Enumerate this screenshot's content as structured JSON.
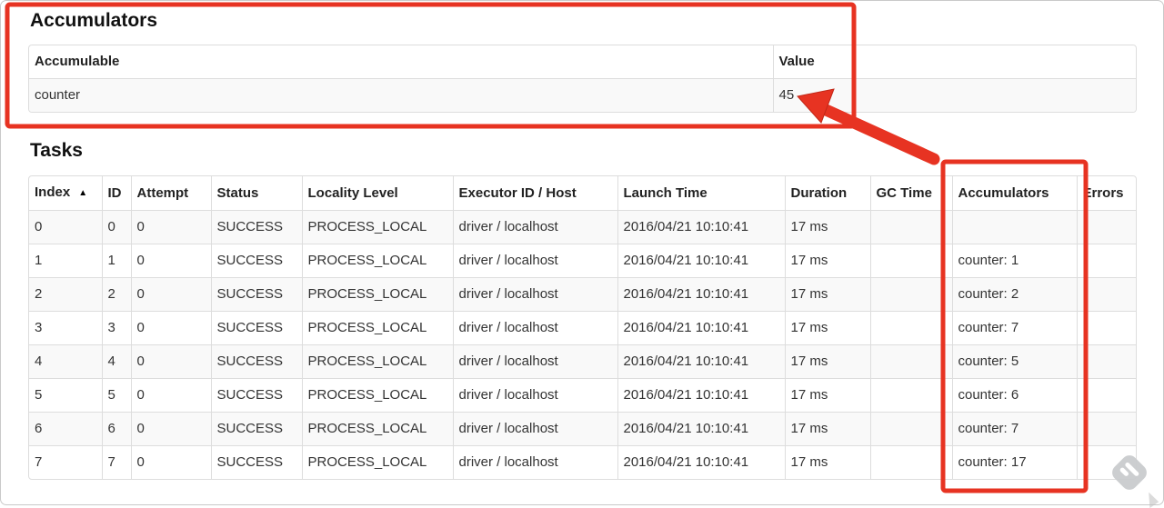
{
  "accumulators_section": {
    "title": "Accumulators",
    "table": {
      "headers": [
        "Accumulable",
        "Value"
      ],
      "rows": [
        [
          "counter",
          "45"
        ]
      ]
    }
  },
  "tasks_section": {
    "title": "Tasks",
    "table": {
      "columns": [
        {
          "label": "Index",
          "sort": "▲"
        },
        {
          "label": "ID"
        },
        {
          "label": "Attempt"
        },
        {
          "label": "Status"
        },
        {
          "label": "Locality Level"
        },
        {
          "label": "Executor ID / Host"
        },
        {
          "label": "Launch Time"
        },
        {
          "label": "Duration"
        },
        {
          "label": "GC Time"
        },
        {
          "label": "Accumulators"
        },
        {
          "label": "Errors"
        }
      ],
      "rows": [
        [
          "0",
          "0",
          "0",
          "SUCCESS",
          "PROCESS_LOCAL",
          "driver / localhost",
          "2016/04/21 10:10:41",
          "17 ms",
          "",
          "",
          ""
        ],
        [
          "1",
          "1",
          "0",
          "SUCCESS",
          "PROCESS_LOCAL",
          "driver / localhost",
          "2016/04/21 10:10:41",
          "17 ms",
          "",
          "counter: 1",
          ""
        ],
        [
          "2",
          "2",
          "0",
          "SUCCESS",
          "PROCESS_LOCAL",
          "driver / localhost",
          "2016/04/21 10:10:41",
          "17 ms",
          "",
          "counter: 2",
          ""
        ],
        [
          "3",
          "3",
          "0",
          "SUCCESS",
          "PROCESS_LOCAL",
          "driver / localhost",
          "2016/04/21 10:10:41",
          "17 ms",
          "",
          "counter: 7",
          ""
        ],
        [
          "4",
          "4",
          "0",
          "SUCCESS",
          "PROCESS_LOCAL",
          "driver / localhost",
          "2016/04/21 10:10:41",
          "17 ms",
          "",
          "counter: 5",
          ""
        ],
        [
          "5",
          "5",
          "0",
          "SUCCESS",
          "PROCESS_LOCAL",
          "driver / localhost",
          "2016/04/21 10:10:41",
          "17 ms",
          "",
          "counter: 6",
          ""
        ],
        [
          "6",
          "6",
          "0",
          "SUCCESS",
          "PROCESS_LOCAL",
          "driver / localhost",
          "2016/04/21 10:10:41",
          "17 ms",
          "",
          "counter: 7",
          ""
        ],
        [
          "7",
          "7",
          "0",
          "SUCCESS",
          "PROCESS_LOCAL",
          "driver / localhost",
          "2016/04/21 10:10:41",
          "17 ms",
          "",
          "counter: 17",
          ""
        ]
      ]
    }
  },
  "annotations": {
    "highlight_color": "#e73322"
  },
  "icons": {
    "sort_ascending": "▲",
    "watermark": "feedly-badge"
  }
}
